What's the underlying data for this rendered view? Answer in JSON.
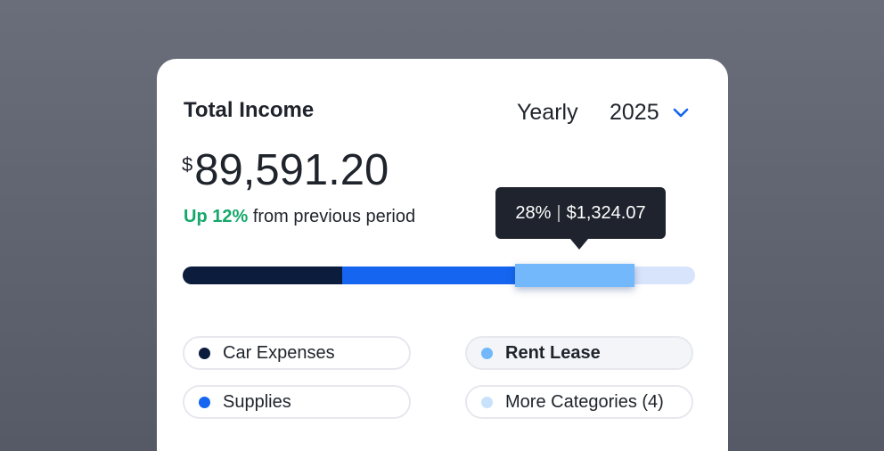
{
  "card": {
    "title": "Total Income",
    "period": "Yearly",
    "year": "2025",
    "currency": "$",
    "amount": "89,591.20",
    "change_up": "Up 12%",
    "change_rest": "from previous period"
  },
  "tooltip": {
    "percent": "28%",
    "separator": "|",
    "value": "$1,324.07"
  },
  "progress": {
    "segments": [
      {
        "name": "Car Expenses",
        "fraction": 0.31,
        "color": "#0b1c3d"
      },
      {
        "name": "Supplies",
        "fraction": 0.34,
        "color": "#1565f0"
      },
      {
        "name": "Rent Lease",
        "fraction": 0.23,
        "color": "#72b8fb"
      },
      {
        "name": "More Categories",
        "fraction": 0.12,
        "color": "#d8e4fb"
      }
    ]
  },
  "legend": {
    "items": [
      {
        "label": "Car Expenses",
        "color": "#0b1c3d"
      },
      {
        "label": "Supplies",
        "color": "#1565f0"
      },
      {
        "label": "Rent Lease",
        "color": "#72b8fb"
      },
      {
        "label": "More Categories (4)",
        "color": "#c9e2fb"
      }
    ]
  },
  "icons": {
    "year_dropdown": "chevron-down-icon"
  }
}
